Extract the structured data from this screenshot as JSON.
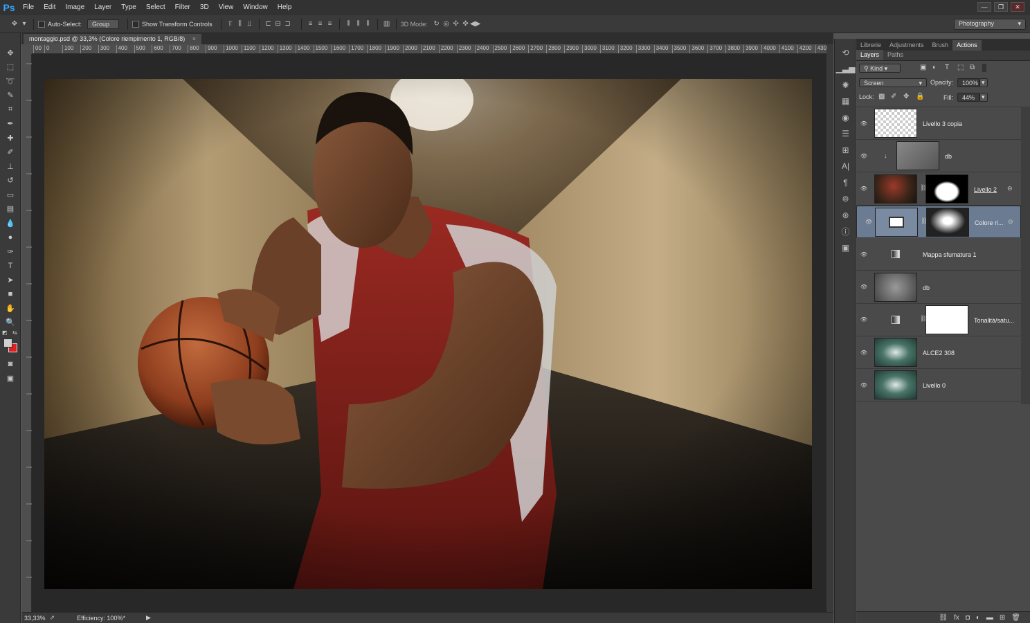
{
  "app": {
    "logo": "Ps"
  },
  "menu": [
    "File",
    "Edit",
    "Image",
    "Layer",
    "Type",
    "Select",
    "Filter",
    "3D",
    "View",
    "Window",
    "Help"
  ],
  "window_controls": {
    "minimize": "—",
    "restore": "❐",
    "close": "✕"
  },
  "options": {
    "auto_select_label": "Auto-Select:",
    "auto_select_value": "Group",
    "show_transform_label": "Show Transform Controls",
    "mode_3d_label": "3D Mode:"
  },
  "workspace": "Photography",
  "document": {
    "tab_title": "montaggio.psd @ 33,3% (Colore riempimento 1, RGB/8)",
    "tab_close": "×",
    "ruler_h": [
      "00",
      "0",
      "100",
      "200",
      "300",
      "400",
      "500",
      "600",
      "700",
      "800",
      "900",
      "1000",
      "1100",
      "1200",
      "1300",
      "1400",
      "1500",
      "1600",
      "1700",
      "1800",
      "1900",
      "2000",
      "2100",
      "2200",
      "2300",
      "2400",
      "2500",
      "2600",
      "2700",
      "2800",
      "2900",
      "3000",
      "3100",
      "3200",
      "3300",
      "3400",
      "3500",
      "3600",
      "3700",
      "3800",
      "3900",
      "4000",
      "4100",
      "4200",
      "430"
    ]
  },
  "status": {
    "zoom": "33,33%",
    "efficiency": "Efficiency: 100%*"
  },
  "panels": {
    "top_tabs": [
      "Librerie",
      "Adjustments",
      "Brush",
      "Actions"
    ],
    "top_active": "Actions",
    "layer_tabs": [
      "Layers",
      "Paths"
    ],
    "filter_kind": "Kind",
    "blend_mode": "Screen",
    "opacity_label": "Opacity:",
    "opacity_value": "100%",
    "lock_label": "Lock:",
    "fill_label": "Fill:",
    "fill_value": "44%"
  },
  "layers": [
    {
      "name": "Livello 3 copia",
      "kind": "transparent",
      "selected": false
    },
    {
      "name": "db",
      "kind": "clipped",
      "selected": false
    },
    {
      "name": "Livello 2",
      "kind": "photo-mask",
      "selected": false
    },
    {
      "name": "Colore ri...",
      "kind": "fill-mask",
      "selected": true
    },
    {
      "name": "Mappa sfumatura 1",
      "kind": "adjust",
      "selected": false
    },
    {
      "name": "db",
      "kind": "gray",
      "selected": false
    },
    {
      "name": "Tonalità/satu...",
      "kind": "adjust-mask",
      "selected": false
    },
    {
      "name": "ALCE2 308",
      "kind": "tunnel",
      "selected": false
    },
    {
      "name": "Livello 0",
      "kind": "tunnel",
      "selected": false
    }
  ],
  "icons": {
    "eye": "eye-icon",
    "chain": "chain-icon"
  }
}
